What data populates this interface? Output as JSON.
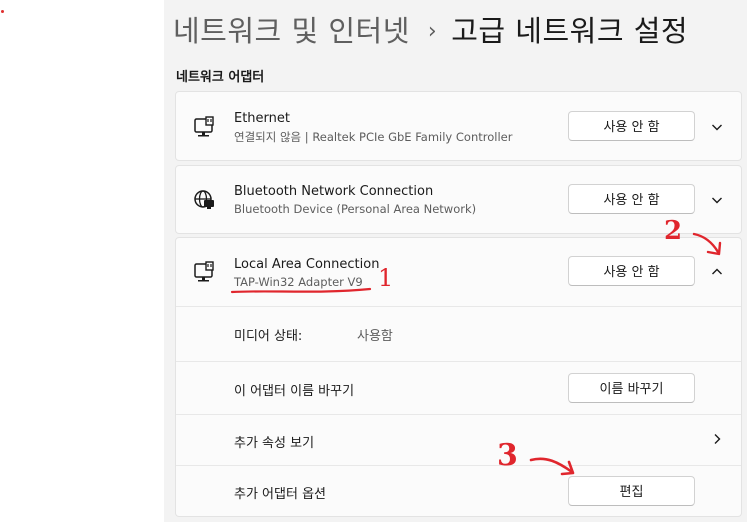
{
  "breadcrumb": {
    "parent": "네트워크 및 인터넷",
    "separator": "›",
    "current": "고급 네트워크 설정"
  },
  "section": {
    "title": "네트워크 어댑터"
  },
  "adapters": [
    {
      "name": "Ethernet",
      "description": "연결되지 않음 | Realtek PCIe GbE Family Controller",
      "button": "사용 안 함",
      "icon": "ethernet-icon",
      "expanded": false
    },
    {
      "name": "Bluetooth Network Connection",
      "description": "Bluetooth Device (Personal Area Network)",
      "button": "사용 안 함",
      "icon": "globe-monitor-icon",
      "expanded": false
    },
    {
      "name": "Local Area Connection",
      "description": "TAP-Win32 Adapter V9",
      "button": "사용 안 함",
      "icon": "ethernet-icon",
      "expanded": true
    }
  ],
  "details": {
    "media_state_label": "미디어 상태:",
    "media_state_value": "사용함",
    "rename_label": "이 어댑터 이름 바꾸기",
    "rename_button": "이름 바꾸기",
    "more_properties_label": "추가 속성 보기",
    "more_options_label": "추가 어댑터 옵션",
    "edit_button": "편집"
  },
  "annotations": {
    "marker_1": "1",
    "marker_2": "2",
    "marker_3": "3",
    "color": "#e0262d"
  }
}
